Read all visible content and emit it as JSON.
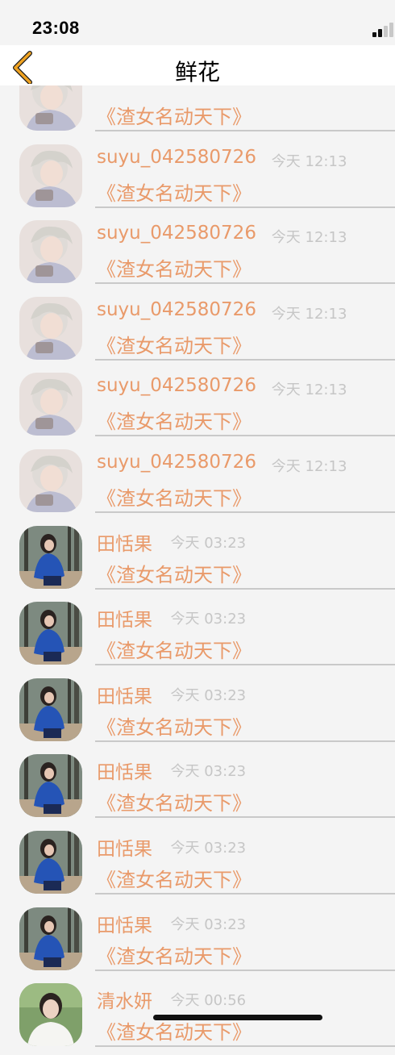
{
  "status_bar": {
    "time": "23:08"
  },
  "nav": {
    "title": "鲜花",
    "back_icon": "chevron-left-icon",
    "back_color": "#f0a322"
  },
  "colors": {
    "accent": "#e99a6a",
    "timestamp": "#c6c6c6",
    "background": "#f4f4f4"
  },
  "list": {
    "items": [
      {
        "name": "",
        "time": "",
        "message": "《渣女名动天下》",
        "avatar": "avatar-illustrated-boy"
      },
      {
        "name": "suyu_042580726",
        "time": "今天 12:13",
        "message": "《渣女名动天下》",
        "avatar": "avatar-illustrated-boy"
      },
      {
        "name": "suyu_042580726",
        "time": "今天 12:13",
        "message": "《渣女名动天下》",
        "avatar": "avatar-illustrated-boy"
      },
      {
        "name": "suyu_042580726",
        "time": "今天 12:13",
        "message": "《渣女名动天下》",
        "avatar": "avatar-illustrated-boy"
      },
      {
        "name": "suyu_042580726",
        "time": "今天 12:13",
        "message": "《渣女名动天下》",
        "avatar": "avatar-illustrated-boy"
      },
      {
        "name": "suyu_042580726",
        "time": "今天 12:13",
        "message": "《渣女名动天下》",
        "avatar": "avatar-illustrated-boy"
      },
      {
        "name": "田恬果",
        "time": "今天 03:23",
        "message": "《渣女名动天下》",
        "avatar": "avatar-girl-blue-jacket"
      },
      {
        "name": "田恬果",
        "time": "今天 03:23",
        "message": "《渣女名动天下》",
        "avatar": "avatar-girl-blue-jacket"
      },
      {
        "name": "田恬果",
        "time": "今天 03:23",
        "message": "《渣女名动天下》",
        "avatar": "avatar-girl-blue-jacket"
      },
      {
        "name": "田恬果",
        "time": "今天 03:23",
        "message": "《渣女名动天下》",
        "avatar": "avatar-girl-blue-jacket"
      },
      {
        "name": "田恬果",
        "time": "今天 03:23",
        "message": "《渣女名动天下》",
        "avatar": "avatar-girl-blue-jacket"
      },
      {
        "name": "田恬果",
        "time": "今天 03:23",
        "message": "《渣女名动天下》",
        "avatar": "avatar-girl-blue-jacket"
      },
      {
        "name": "清水妍",
        "time": "今天 00:56",
        "message": "《渣女名动天下》",
        "avatar": "avatar-man-white-shirt"
      }
    ]
  }
}
